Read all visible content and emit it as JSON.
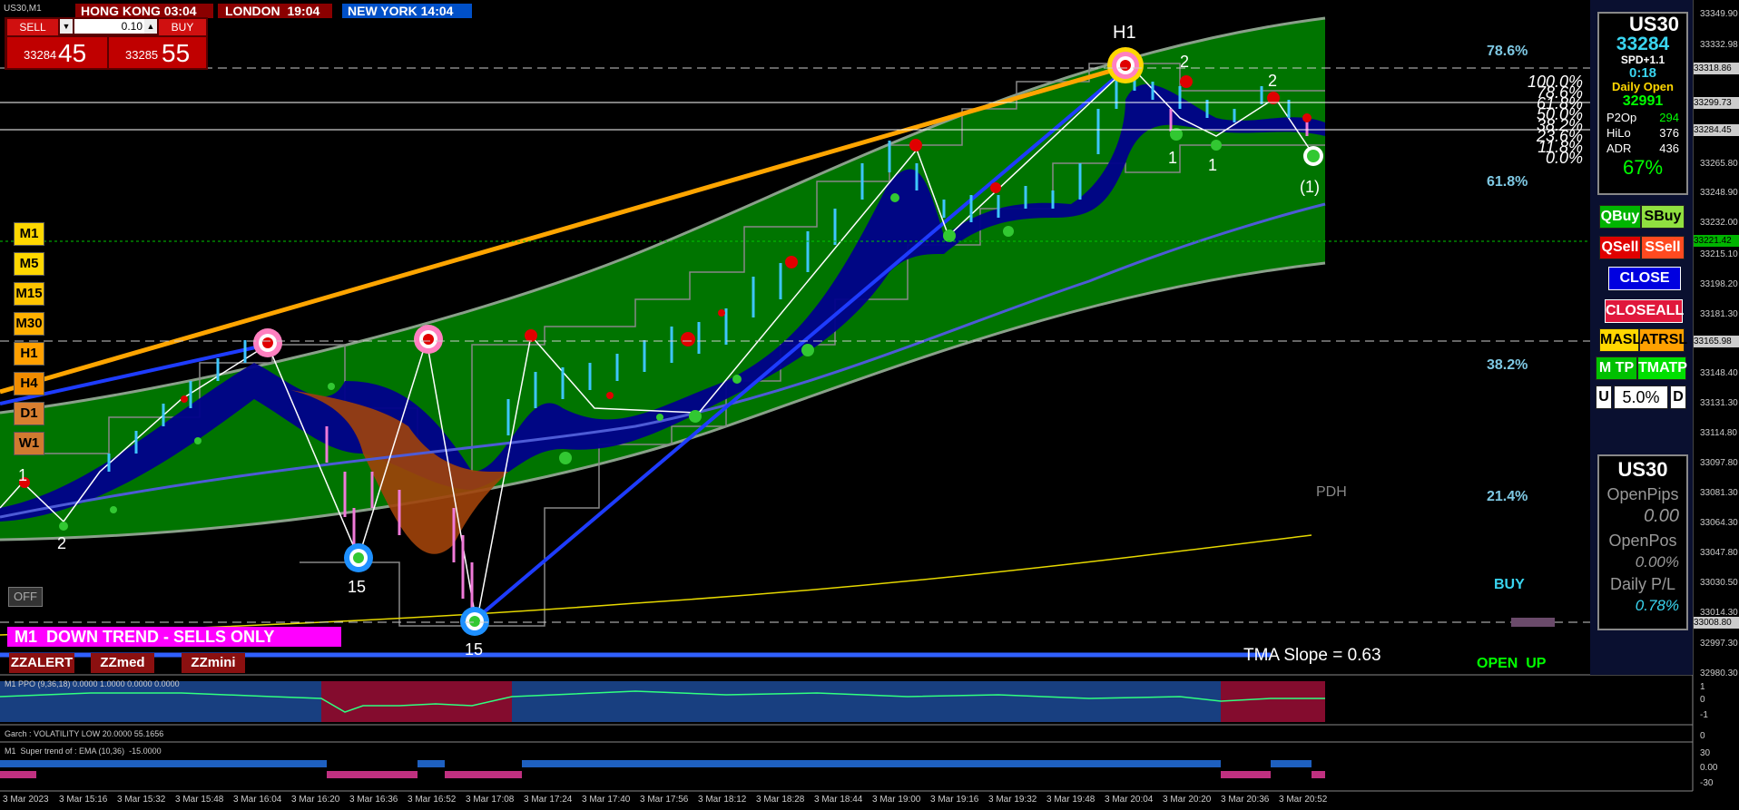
{
  "window": {
    "title": "US30,M1"
  },
  "sessions": [
    {
      "label": "HONG KONG",
      "time": "03:04",
      "color": "#8b0000"
    },
    {
      "label": "LONDON",
      "time": "19:04",
      "color": "#8b0000"
    },
    {
      "label": "NEW YORK",
      "time": "14:04",
      "color": "#0050c8"
    }
  ],
  "one_click": {
    "sell_label": "SELL",
    "buy_label": "BUY",
    "lot": "0.10",
    "sell_price_small": "33284",
    "sell_price_big": "45",
    "buy_price_small": "33285",
    "buy_price_big": "55"
  },
  "timeframes": [
    "M1",
    "M5",
    "M15",
    "M30",
    "H1",
    "H4",
    "D1",
    "W1"
  ],
  "off_button": "OFF",
  "trend_banner": "M1  DOWN TREND - SELLS ONLY",
  "zz_buttons": [
    "ZZALERT",
    "ZZmed",
    "ZZmini"
  ],
  "tma_slope": "TMA Slope = 0.63",
  "pdh_label": "PDH",
  "buy_label": "BUY",
  "open_up_label": "OPEN  UP",
  "fib_right": [
    "78.6%",
    "61.8%",
    "38.2%",
    "21.4%"
  ],
  "fib_stack": [
    "100.0%",
    "78.6%",
    "61.8%",
    "50.0%",
    "38.2%",
    "23.6%",
    "11.8%",
    "0.0%"
  ],
  "zigzag_labels": {
    "h1": "H1",
    "n1": "1",
    "n2": "2",
    "n15": "15",
    "paren1": "(1)"
  },
  "info_panel": {
    "symbol": "US30",
    "price": "33284",
    "spread": "SPD+1.1",
    "timer": "0:18",
    "daily_open_label": "Daily Open",
    "daily_open": "32991",
    "p2op_label": "P2Op",
    "p2op": "294",
    "hilo_label": "HiLo",
    "hilo": "376",
    "adr_label": "ADR",
    "adr": "436",
    "percent": "67%"
  },
  "trade_buttons": {
    "qbuy": "QBuy",
    "sbuy": "SBuy",
    "qsell": "QSell",
    "ssell": "SSell",
    "close": "CLOSE",
    "closeall": "CLOSEALL",
    "masl": "MASL",
    "atrsl": "ATRSL",
    "mtp": "M TP",
    "tmatp": "TMATP",
    "u": "U",
    "risk": "5.0%",
    "d": "D"
  },
  "pos_panel": {
    "symbol": "US30",
    "open_pips_label": "OpenPips",
    "open_pips": "0.00",
    "open_pos_label": "OpenPos",
    "open_pos": "0.00%",
    "daily_pl_label": "Daily P/L",
    "daily_pl": "0.78%"
  },
  "price_axis": [
    "33349.90",
    "33332.98",
    "33318.86",
    "33299.73",
    "33284.45",
    "33265.80",
    "33248.90",
    "33232.00",
    "33221.42",
    "33215.10",
    "33198.20",
    "33181.30",
    "33165.98",
    "33148.40",
    "33131.30",
    "33114.80",
    "33097.80",
    "33081.30",
    "33064.30",
    "33047.80",
    "33030.50",
    "33014.30",
    "33008.80",
    "32997.30",
    "32980.30"
  ],
  "indicators": {
    "ppo": {
      "label": "M1 PPO (9,36,18) 0.0000 1.0000 0.0000 0.0000",
      "scale": [
        "1",
        "0",
        "-1"
      ]
    },
    "garch": {
      "label": "Garch : VOLATILITY LOW 20.0000 55.1656",
      "scale": [
        "0"
      ]
    },
    "supertrend": {
      "label": "M1  Super trend of : EMA (10,36)  -15.0000",
      "scale": [
        "30",
        "0.00",
        "-30"
      ]
    }
  },
  "time_axis": [
    "3 Mar 2023",
    "3 Mar 15:16",
    "3 Mar 15:32",
    "3 Mar 15:48",
    "3 Mar 16:04",
    "3 Mar 16:20",
    "3 Mar 16:36",
    "3 Mar 16:52",
    "3 Mar 17:08",
    "3 Mar 17:24",
    "3 Mar 17:40",
    "3 Mar 17:56",
    "3 Mar 18:12",
    "3 Mar 18:28",
    "3 Mar 18:44",
    "3 Mar 19:00",
    "3 Mar 19:16",
    "3 Mar 19:32",
    "3 Mar 19:48",
    "3 Mar 20:04",
    "3 Mar 20:20",
    "3 Mar 20:36",
    "3 Mar 20:52"
  ],
  "colors": {
    "channel": "#007a00",
    "cloud": "#00008b",
    "orange_trend": "#ffa500",
    "blue_trend": "#1e3cff",
    "banner": "#ff00ff"
  }
}
